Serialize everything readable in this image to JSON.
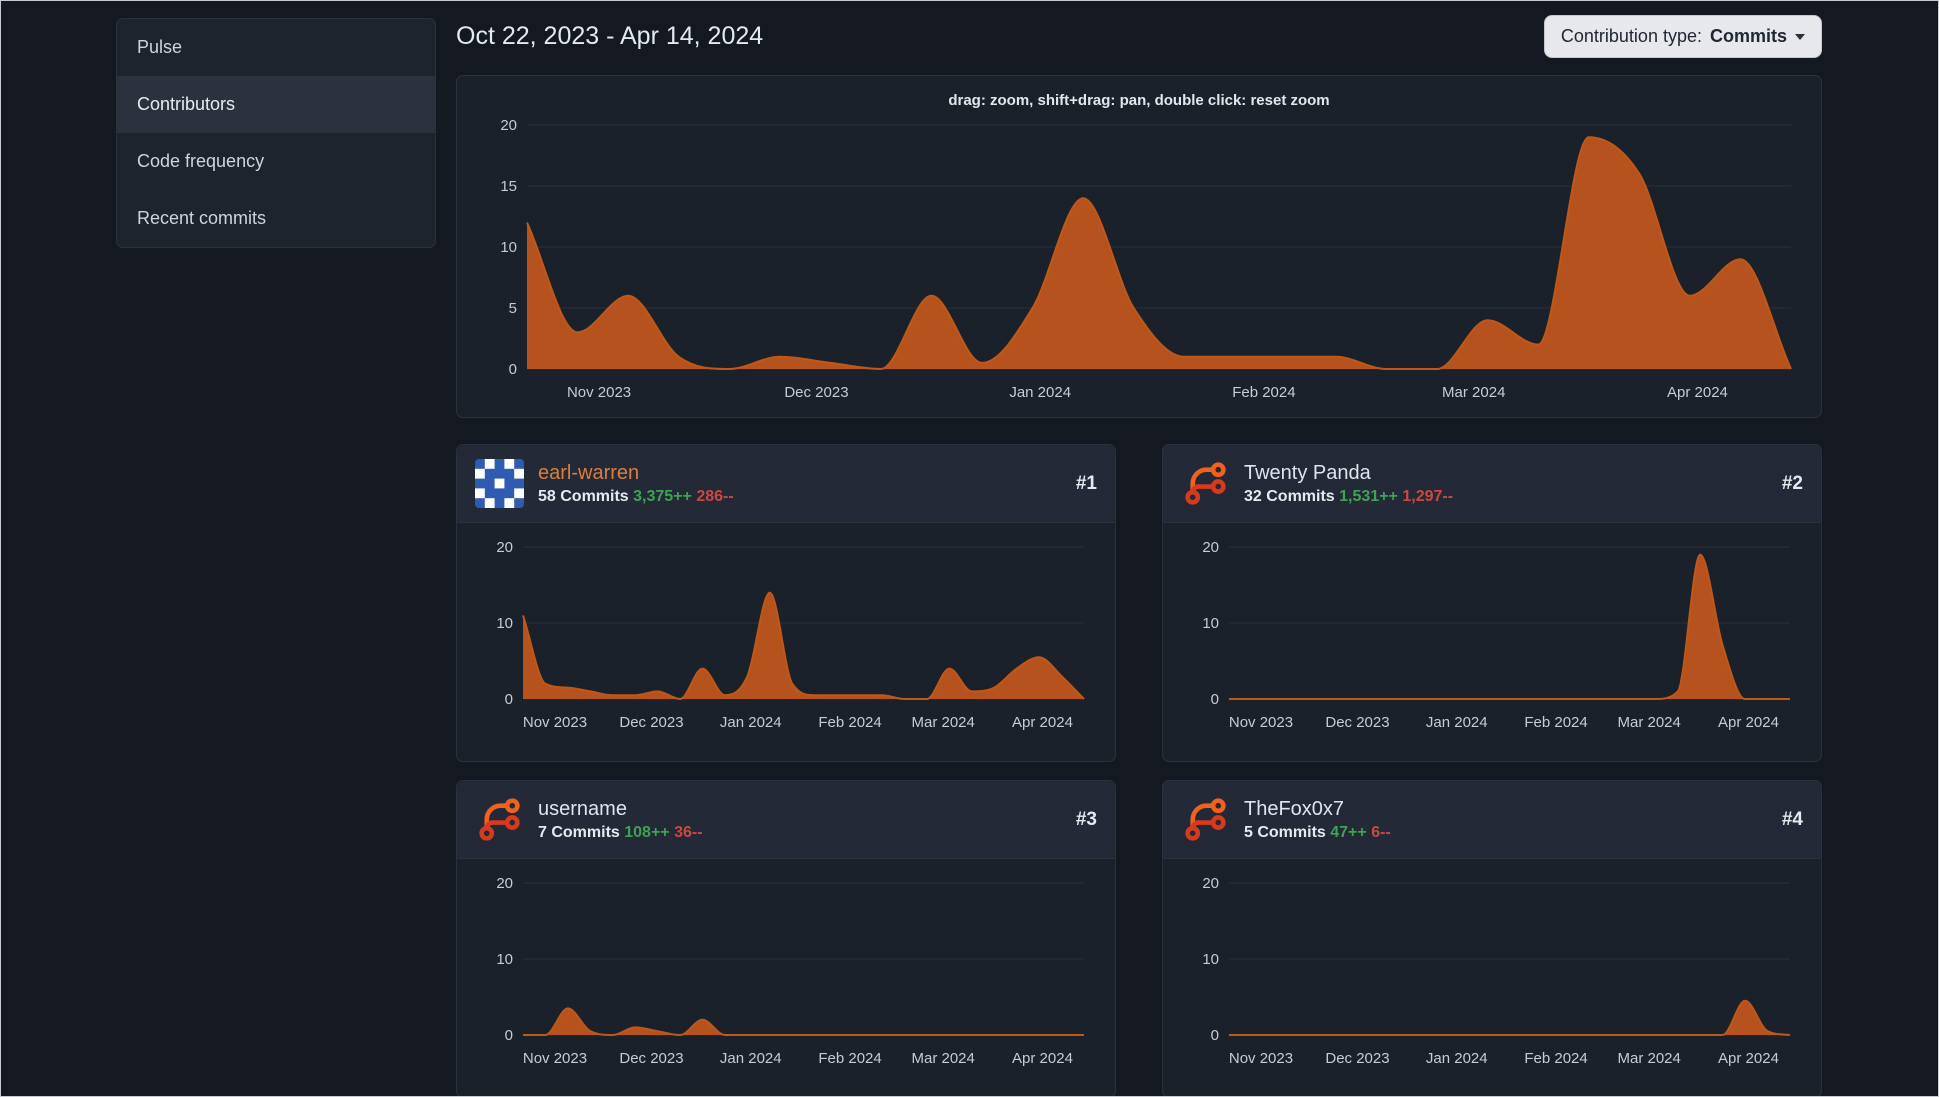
{
  "colors": {
    "page_bg": "#141821",
    "card_bg": "#1b212b",
    "card_header_bg": "#232936",
    "border": "#2b323e",
    "sidebar_bg": "#1e242e",
    "sidebar_active_bg": "#2b323e",
    "chart_fill": "#b5521d",
    "chart_line": "#c25817",
    "grid_line": "#2b313c",
    "green": "#40a254",
    "red": "#cb4942",
    "name_link_orange": "#dd7e3a",
    "button_bg": "#e6e8ec",
    "button_text": "#202632"
  },
  "sidebar": {
    "items": [
      {
        "label": "Pulse",
        "active": false
      },
      {
        "label": "Contributors",
        "active": true
      },
      {
        "label": "Code frequency",
        "active": false
      },
      {
        "label": "Recent commits",
        "active": false
      }
    ]
  },
  "header": {
    "date_range": "Oct 22, 2023 - Apr 14, 2024"
  },
  "contribution_type": {
    "label": "Contribution type:",
    "value": "Commits"
  },
  "main_chart": {
    "hint": "drag: zoom, shift+drag: pan, double click: reset zoom"
  },
  "contributors": [
    {
      "rank": "#1",
      "name": "earl-warren",
      "commits": "58 Commits",
      "additions": "3,375++",
      "deletions": "286--"
    },
    {
      "rank": "#2",
      "name": "Twenty Panda",
      "commits": "32 Commits",
      "additions": "1,531++",
      "deletions": "1,297--"
    },
    {
      "rank": "#3",
      "name": "username",
      "commits": "7 Commits",
      "additions": "108++",
      "deletions": "36--"
    },
    {
      "rank": "#4",
      "name": "TheFox0x7",
      "commits": "5 Commits",
      "additions": "47++",
      "deletions": "6--"
    }
  ],
  "chart_data": [
    {
      "id": "overall-activity",
      "type": "area",
      "series_label": "Commits",
      "date_start": "Oct 22, 2023",
      "date_end": "Apr 14, 2024",
      "interval": "weekly",
      "ylim": [
        0,
        20
      ],
      "yticks": [
        0,
        5,
        10,
        15,
        20
      ],
      "x_ticks": {
        "labels": [
          "Nov 2023",
          "Dec 2023",
          "Jan 2024",
          "Feb 2024",
          "Mar 2024",
          "Apr 2024"
        ],
        "fractions": [
          0.057,
          0.229,
          0.406,
          0.583,
          0.749,
          0.926
        ]
      },
      "values": [
        12,
        3,
        6,
        1,
        0,
        1,
        0.5,
        0,
        6,
        0.5,
        5,
        14,
        5,
        1,
        1,
        1,
        1,
        0,
        0,
        4,
        2,
        19,
        16,
        6,
        9,
        0
      ]
    },
    {
      "id": "earl-warren",
      "type": "area",
      "series_label": "Commits",
      "date_start": "Oct 22, 2023",
      "date_end": "Apr 14, 2024",
      "interval": "weekly",
      "ylim": [
        0,
        20
      ],
      "yticks": [
        0,
        10,
        20
      ],
      "x_ticks": {
        "labels": [
          "Nov 2023",
          "Dec 2023",
          "Jan 2024",
          "Feb 2024",
          "Mar 2024",
          "Apr 2024"
        ],
        "fractions": [
          0.057,
          0.229,
          0.406,
          0.583,
          0.749,
          0.926
        ]
      },
      "values": [
        11,
        2,
        1.5,
        1,
        0.5,
        0.5,
        1,
        0,
        4,
        0.5,
        3,
        14,
        2,
        0.5,
        0.5,
        0.5,
        0.5,
        0,
        0,
        4,
        1,
        1.5,
        4,
        5.5,
        3,
        0
      ]
    },
    {
      "id": "twenty-panda",
      "type": "area",
      "series_label": "Commits",
      "date_start": "Oct 22, 2023",
      "date_end": "Apr 14, 2024",
      "interval": "weekly",
      "ylim": [
        0,
        20
      ],
      "yticks": [
        0,
        10,
        20
      ],
      "x_ticks": {
        "labels": [
          "Nov 2023",
          "Dec 2023",
          "Jan 2024",
          "Feb 2024",
          "Mar 2024",
          "Apr 2024"
        ],
        "fractions": [
          0.057,
          0.229,
          0.406,
          0.583,
          0.749,
          0.926
        ]
      },
      "values": [
        0,
        0,
        0,
        0,
        0,
        0,
        0,
        0,
        0,
        0,
        0,
        0,
        0,
        0,
        0,
        0,
        0,
        0,
        0,
        0,
        1,
        19,
        7,
        0,
        0,
        0
      ]
    },
    {
      "id": "username",
      "type": "area",
      "series_label": "Commits",
      "date_start": "Oct 22, 2023",
      "date_end": "Apr 14, 2024",
      "interval": "weekly",
      "ylim": [
        0,
        20
      ],
      "yticks": [
        0,
        10,
        20
      ],
      "x_ticks": {
        "labels": [
          "Nov 2023",
          "Dec 2023",
          "Jan 2024",
          "Feb 2024",
          "Mar 2024",
          "Apr 2024"
        ],
        "fractions": [
          0.057,
          0.229,
          0.406,
          0.583,
          0.749,
          0.926
        ]
      },
      "values": [
        0,
        0,
        3.5,
        0.5,
        0,
        1,
        0.5,
        0,
        2,
        0,
        0,
        0,
        0,
        0,
        0,
        0,
        0,
        0,
        0,
        0,
        0,
        0,
        0,
        0,
        0,
        0
      ]
    },
    {
      "id": "thefox0x7",
      "type": "area",
      "series_label": "Commits",
      "date_start": "Oct 22, 2023",
      "date_end": "Apr 14, 2024",
      "interval": "weekly",
      "ylim": [
        0,
        20
      ],
      "yticks": [
        0,
        10,
        20
      ],
      "x_ticks": {
        "labels": [
          "Nov 2023",
          "Dec 2023",
          "Jan 2024",
          "Feb 2024",
          "Mar 2024",
          "Apr 2024"
        ],
        "fractions": [
          0.057,
          0.229,
          0.406,
          0.583,
          0.749,
          0.926
        ]
      },
      "values": [
        0,
        0,
        0,
        0,
        0,
        0,
        0,
        0,
        0,
        0,
        0,
        0,
        0,
        0,
        0,
        0,
        0,
        0,
        0,
        0,
        0,
        0,
        0,
        4.5,
        0.5,
        0
      ]
    }
  ]
}
